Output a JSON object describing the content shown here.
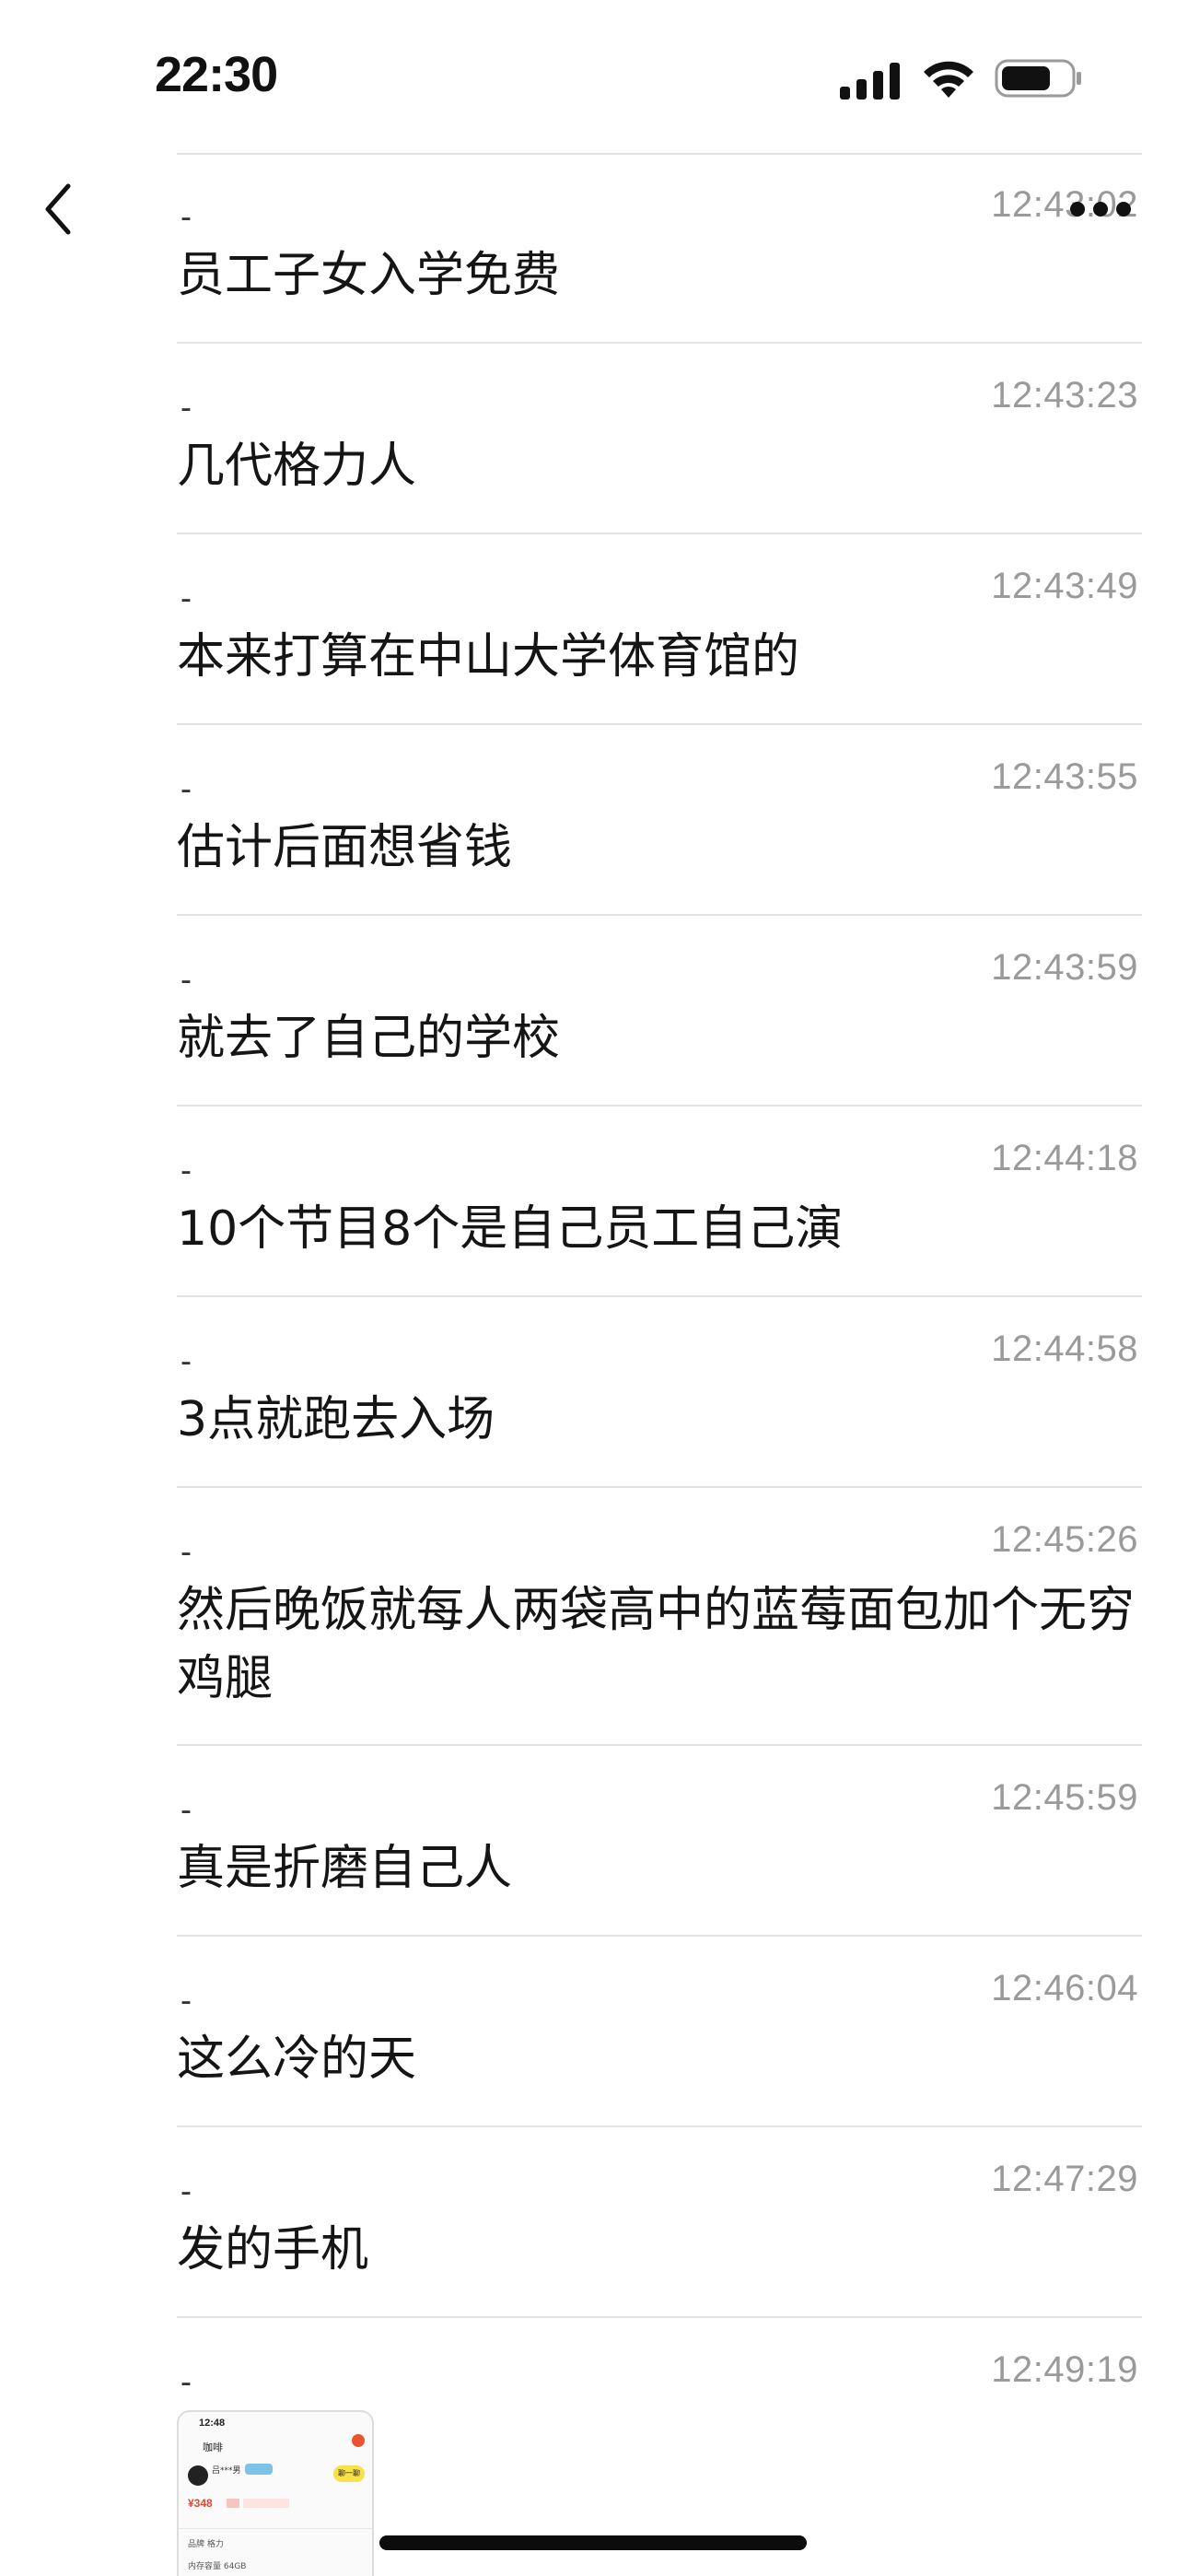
{
  "status_bar": {
    "time": "22:30"
  },
  "nav": {
    "back_icon": "chevron-left-icon",
    "more_icon": "more-dots-icon"
  },
  "messages": [
    {
      "sender": "-",
      "time": "12:43:02",
      "text": "员工子女入学免费"
    },
    {
      "sender": "-",
      "time": "12:43:23",
      "text": "几代格力人"
    },
    {
      "sender": "-",
      "time": "12:43:49",
      "text": "本来打算在中山大学体育馆的"
    },
    {
      "sender": "-",
      "time": "12:43:55",
      "text": "估计后面想省钱"
    },
    {
      "sender": "-",
      "time": "12:43:59",
      "text": "就去了自己的学校"
    },
    {
      "sender": "-",
      "time": "12:44:18",
      "text": "10个节目8个是自己员工自己演"
    },
    {
      "sender": "-",
      "time": "12:44:58",
      "text": "3点就跑去入场"
    },
    {
      "sender": "-",
      "time": "12:45:26",
      "text": "然后晚饭就每人两袋高中的蓝莓面包加个无穷鸡腿"
    },
    {
      "sender": "-",
      "time": "12:45:59",
      "text": "真是折磨自己人"
    },
    {
      "sender": "-",
      "time": "12:46:04",
      "text": "这么冷的天"
    },
    {
      "sender": "-",
      "time": "12:47:29",
      "text": "发的手机"
    },
    {
      "sender": "-",
      "time": "12:49:19",
      "text": ""
    }
  ],
  "image_message": {
    "time": "12:48",
    "title": "咖啡",
    "name": "吕***男",
    "button": "聊一聊",
    "price": "¥348",
    "row1": "品牌  格力",
    "row2": "内存容量  64GB"
  },
  "colors": {
    "divider": "#e3e3e3",
    "timestamp": "#9a9a9a",
    "text": "#151515"
  }
}
